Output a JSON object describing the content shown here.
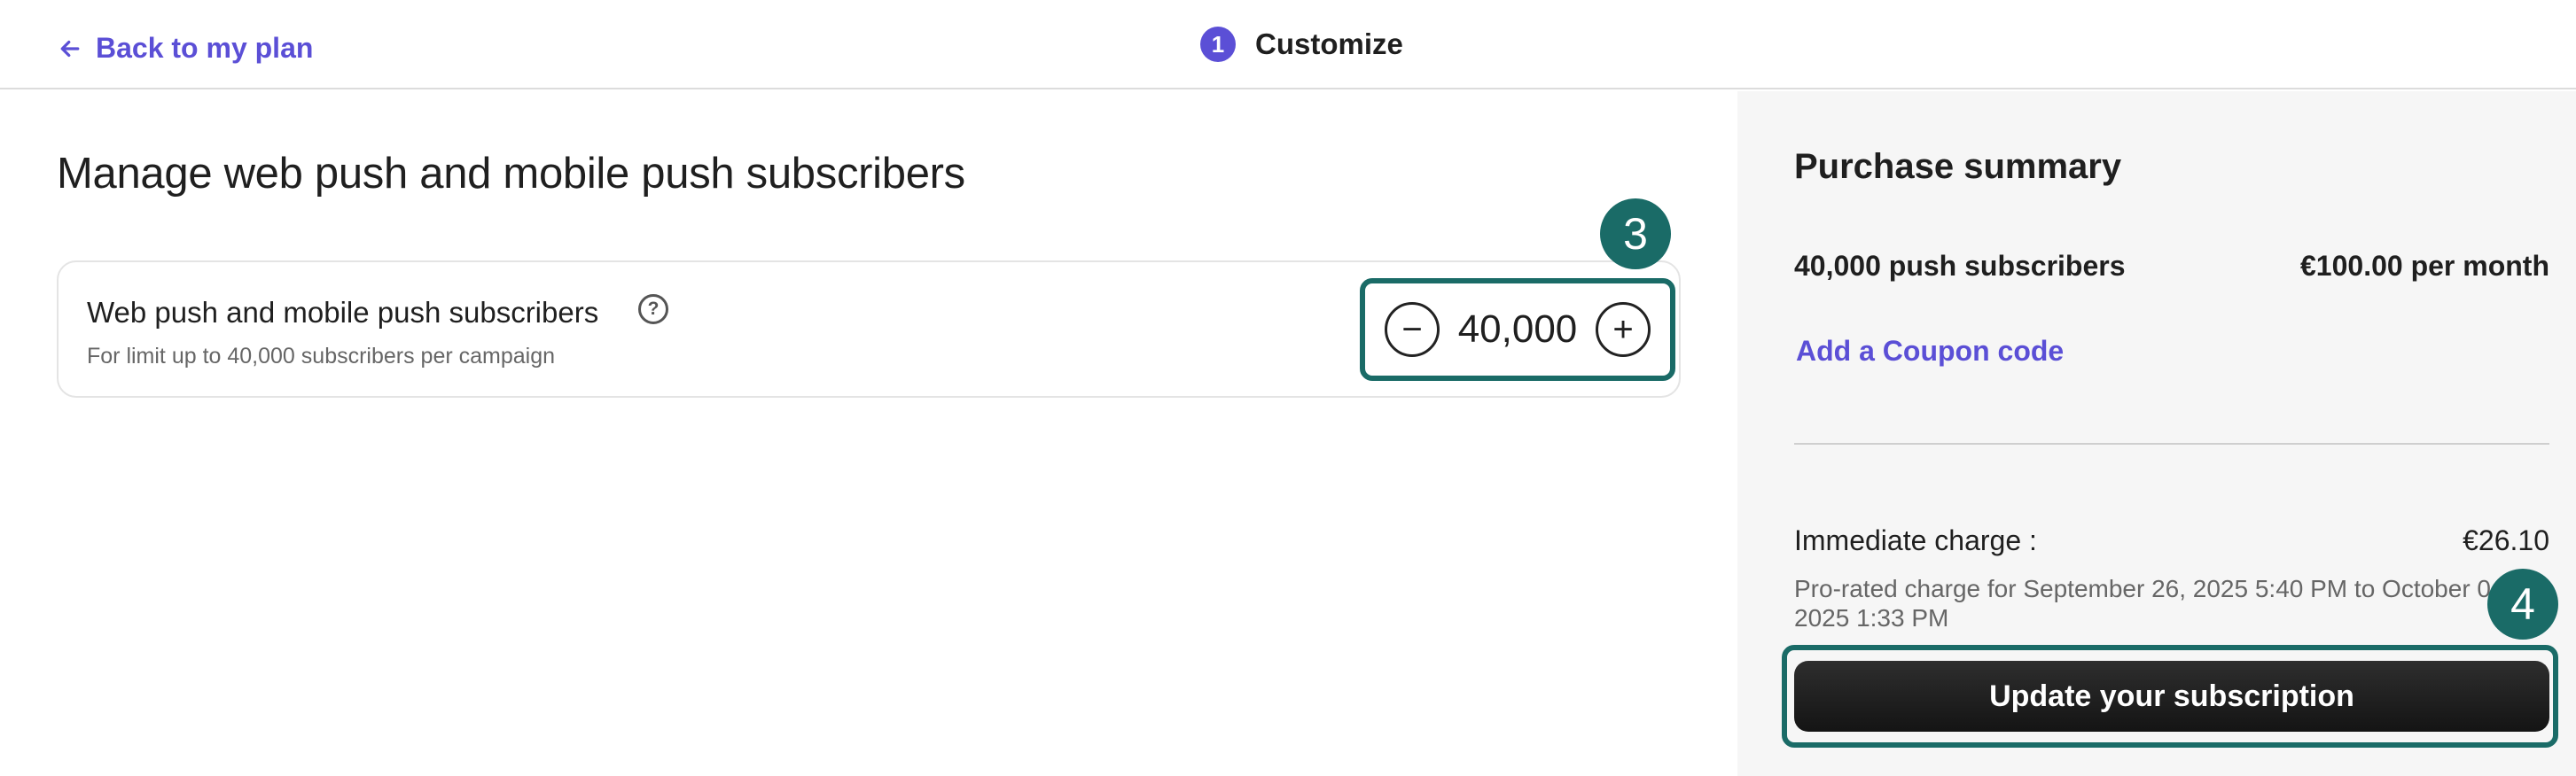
{
  "header": {
    "back_label": "Back to my plan",
    "step_number": "1",
    "step_label": "Customize"
  },
  "main": {
    "title": "Manage web push and mobile push subscribers",
    "card": {
      "title": "Web push and mobile push subscribers",
      "help_glyph": "?",
      "subtitle": "For limit up to 40,000 subscribers per campaign"
    },
    "stepper": {
      "minus": "−",
      "value": "40,000",
      "plus": "+"
    }
  },
  "annotations": {
    "badge_3": "3",
    "badge_4": "4"
  },
  "summary": {
    "title": "Purchase summary",
    "item_label": "40,000 push subscribers",
    "item_price": "€100.00 per month",
    "coupon_label": "Add a Coupon code",
    "immediate_label": "Immediate charge :",
    "immediate_value": "€26.10",
    "prorated_text": "Pro-rated charge for September 26, 2025 5:40 PM to October 04, 2025 1:33 PM",
    "cta_label": "Update your subscription"
  },
  "colors": {
    "accent": "#5b4fd6",
    "annotation": "#1a6b67",
    "sidebar_bg": "#f6f6f6"
  },
  "icons": {
    "back": "arrow-left-icon",
    "help": "question-circle-icon"
  }
}
